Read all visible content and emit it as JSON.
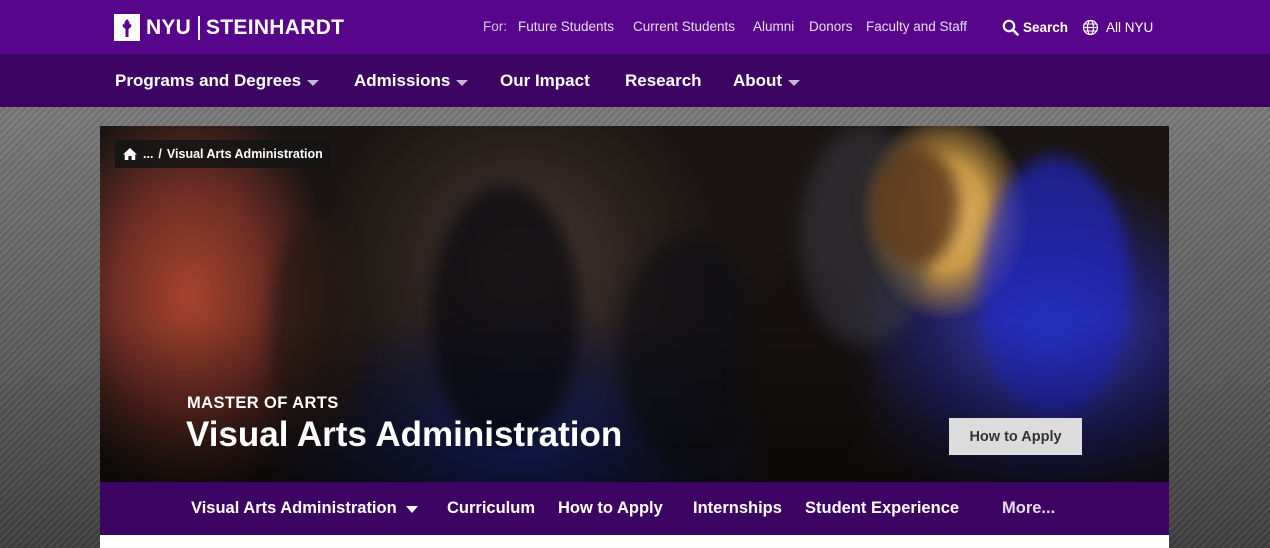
{
  "brand": {
    "university": "NYU",
    "school": "STEINHARDT"
  },
  "utility": {
    "for_label": "For:",
    "audiences": [
      "Future Students",
      "Current Students",
      "Alumni",
      "Donors",
      "Faculty and Staff"
    ],
    "search_label": "Search",
    "all_nyu_label": "All NYU"
  },
  "main_nav": {
    "items": [
      {
        "label": "Programs and Degrees",
        "has_dropdown": true
      },
      {
        "label": "Admissions",
        "has_dropdown": true
      },
      {
        "label": "Our Impact",
        "has_dropdown": false
      },
      {
        "label": "Research",
        "has_dropdown": false
      },
      {
        "label": "About",
        "has_dropdown": true
      }
    ]
  },
  "hero": {
    "breadcrumb_ellipsis": "...",
    "breadcrumb_separator": "/",
    "breadcrumb_current": "Visual Arts Administration",
    "kicker": "MASTER OF ARTS",
    "title": "Visual Arts Administration",
    "cta_label": "How to Apply"
  },
  "program_nav": {
    "items": [
      {
        "label": "Visual Arts Administration",
        "has_dropdown": true
      },
      {
        "label": "Curriculum",
        "has_dropdown": false
      },
      {
        "label": "How to Apply",
        "has_dropdown": false
      },
      {
        "label": "Internships",
        "has_dropdown": false
      },
      {
        "label": "Student Experience",
        "has_dropdown": false
      },
      {
        "label": "More...",
        "has_dropdown": false
      }
    ]
  },
  "colors": {
    "nyu_violet": "#57068c",
    "nav_dark_violet": "#3c0463",
    "button_gray": "#dcdcdc"
  },
  "icons": {
    "logo": "nyu-torch-icon",
    "search": "search-icon",
    "globe": "globe-icon",
    "home": "home-icon",
    "dropdown": "chevron-down-icon"
  }
}
